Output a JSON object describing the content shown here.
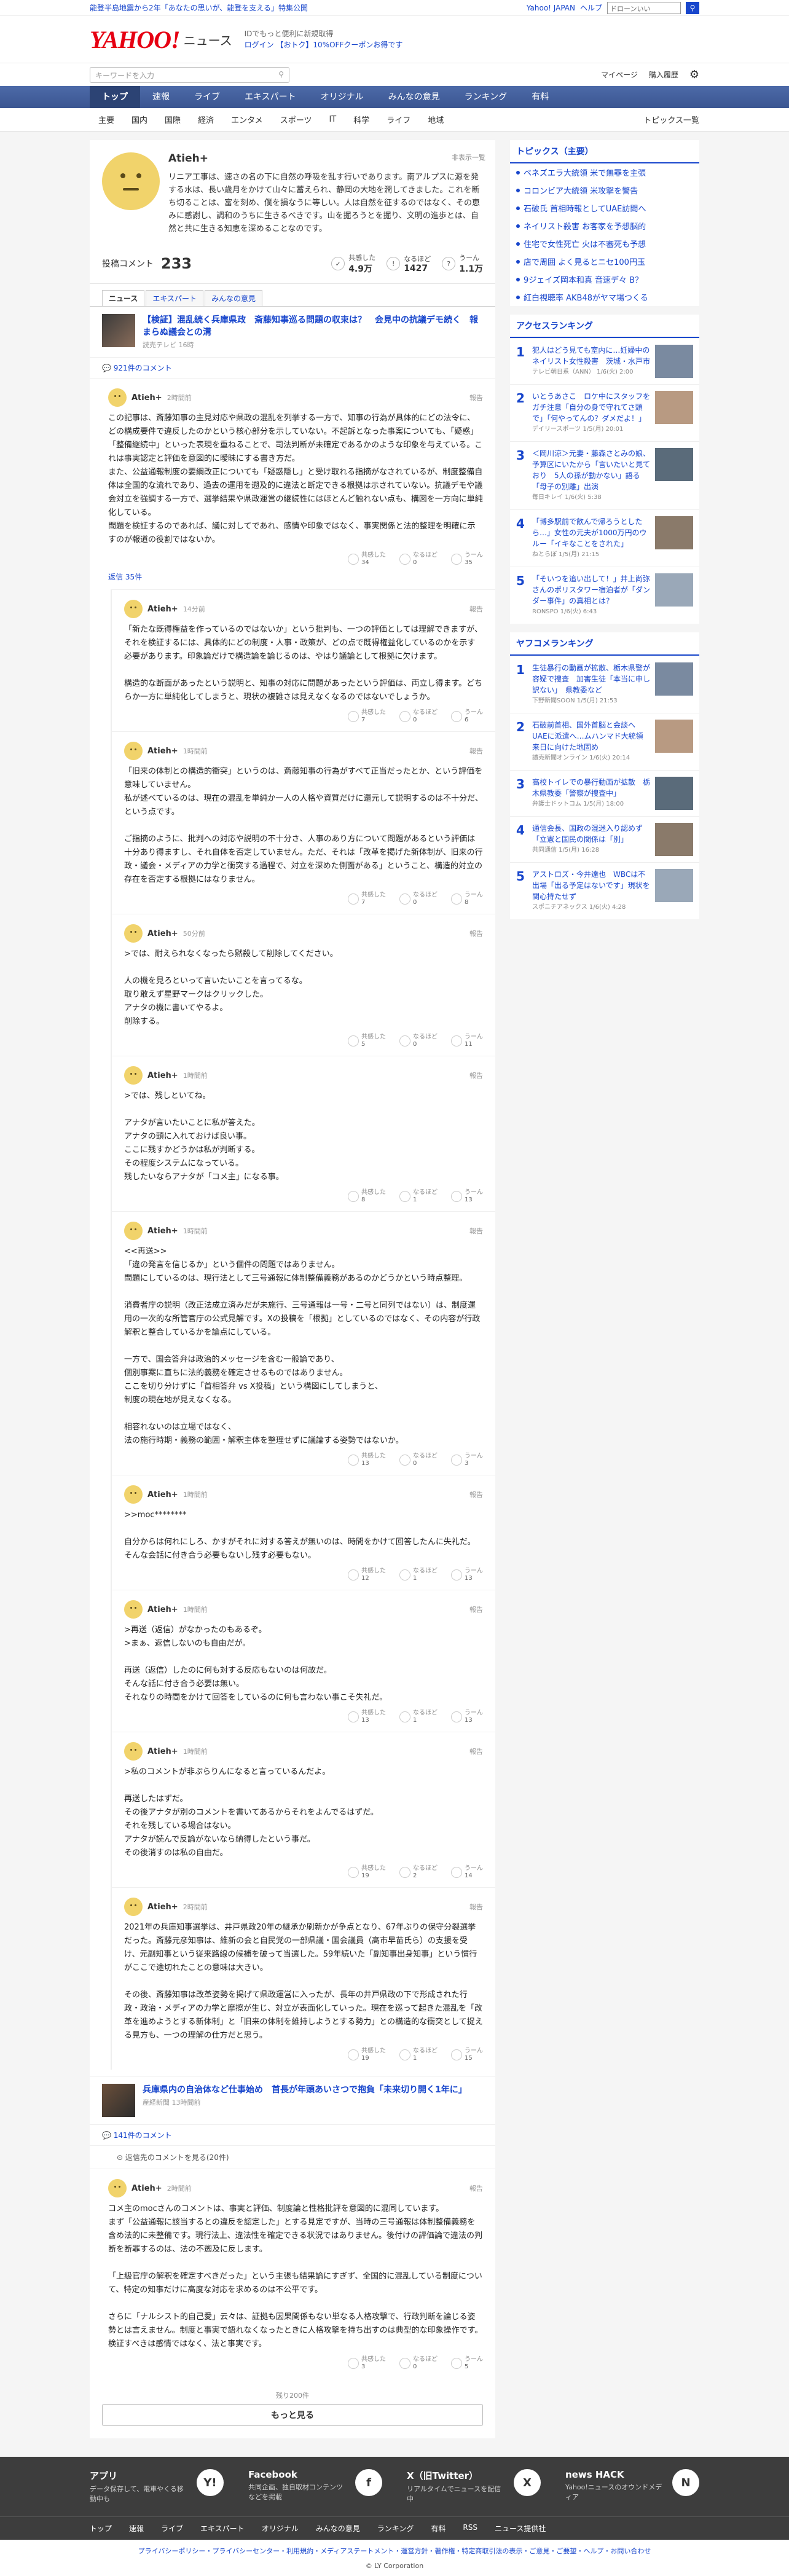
{
  "topbar": {
    "announce": "能登半島地震から2年「あなたの思いが、能登を支える」特集公開",
    "links": [
      "Yahoo! JAPAN",
      "ヘルプ"
    ],
    "search_placeholder": "ウェブ検索",
    "search_value": "ドローンいい"
  },
  "header": {
    "logo": "YAHOO!",
    "logo_sub": "ニュース",
    "promo_line1": "IDでもっと便利に新規取得",
    "promo_line2": "ログイン 【おトク】10%OFFクーポンお得です"
  },
  "search": {
    "placeholder": "キーワードを入力",
    "mypage": "マイページ",
    "purchase": "購入履歴"
  },
  "gnav": [
    "トップ",
    "速報",
    "ライブ",
    "エキスパート",
    "オリジナル",
    "みんなの意見",
    "ランキング",
    "有料"
  ],
  "subnav": [
    "主要",
    "国内",
    "国際",
    "経済",
    "エンタメ",
    "スポーツ",
    "IT",
    "科学",
    "ライフ",
    "地域"
  ],
  "subnav_topics": "トピックス一覧",
  "profile": {
    "name": "Atieh+",
    "hidden_label": "非表示一覧",
    "bio": "リニア工事は、速さの名の下に自然の呼吸を乱す行いであります。南アルプスに源を発する水は、長い歳月をかけて山々に蓄えられ、静岡の大地を潤してきました。これを断ち切ることは、富を刻め、僕を損なうに等しい。人は自然を征するのではなく、その恵みに感謝し、調和のうちに生きるべきです。山を掘ろうとを掘り、文明の進歩とは、自然と共に生きる知恵を深めることなのです。"
  },
  "stats": {
    "label": "投稿コメント",
    "count": "233",
    "m1_label": "共感した",
    "m1": "4.9万",
    "m2_label": "なるほど",
    "m2": "1427",
    "m3_label": "うーん",
    "m3": "1.1万"
  },
  "tabs": [
    "ニュース",
    "エキスパート",
    "みんなの意見"
  ],
  "article1": {
    "title": "【検証】混乱続く兵庫県政　斎藤知事巡る問題の収束は？　会見中の抗議デモ続く　報まらぬ議会との溝",
    "source": "読売テレビ 16時"
  },
  "article1_count": "921件のコメント",
  "comments": [
    {
      "name": "Atieh+",
      "time": "2時間前",
      "body": "この記事は、斎藤知事の主見対応や県政の混乱を列挙する一方で、知事の行為が具体的にどの法令に、どの構成要件で違反したのかという核心部分を示していない。不起訴となった事案についても、「疑惑」「整備継続中」といった表現を重ねることで、司法判断が未確定であるかのような印象を与えている。これは事実認定と評価を意図的に曖昧にする書き方だ。\nまた、公益通報制度の要綱改正についても「疑惑隠し」と受け取れる指摘がなされているが、制度整備自体は全国的な流れであり、過去の運用を遡及的に違法と断定できる根拠は示されていない。抗議デモや議会対立を強調する一方で、選挙結果や県政運営の継続性にはほとんど触れない点も、構図を一方向に単純化している。\n問題を検証するのであれば、議に対してであれ、感情や印象ではなく、事実関係と法的整理を明確に示すのが報道の役割ではないか。",
      "r1": "34",
      "r2": "0",
      "r3": "35",
      "replies": "返信 35件"
    },
    {
      "name": "Atieh+",
      "time": "14分前",
      "body": "「新たな既得権益を作っているのではないか」という批判も、一つの評価としては理解できますが、それを検証するには、具体的にどの制度・人事・政策が、どの点で既得権益化しているのかを示す必要があります。印象論だけで構造論を論じるのは、やはり議論として根拠に欠けます。\n\n構造的な断面があったという説明と、知事の対応に問題があったという評価は、両立し得ます。どちらか一方に単純化してしまうと、現状の複雑さは見えなくなるのではないでしょうか。",
      "r1": "7",
      "r2": "0",
      "r3": "6"
    },
    {
      "name": "Atieh+",
      "time": "1時間前",
      "body": "「旧来の体制との構造的衝突」というのは、斎藤知事の行為がすべて正当だったとか、という評価を意味していません。\n私が述べているのは、現在の混乱を単純か一人の人格や資質だけに還元して説明するのは不十分だ、という点です。\n\nご指摘のように、批判への対応や説明の不十分さ、人事のあり方について問題があるという評価は十分あり得ますし、それ自体を否定していません。ただ、それは「改革を掲げた新体制が、旧来の行政・議会・メディアの力学と衝突する過程で、対立を深めた側面がある」ということ、構造的対立の存在を否定する根拠にはなりません。",
      "r1": "7",
      "r2": "0",
      "r3": "8"
    },
    {
      "name": "Atieh+",
      "time": "50分前",
      "body": ">では、耐えられなくなったら黙殺して削除してください。\n\n人の機を見ろといって言いたいことを言ってるな。\n取り敢えず星野マークはクリックした。\nアナタの機に書いてやるよ。\n削除する。",
      "r1": "5",
      "r2": "0",
      "r3": "11"
    },
    {
      "name": "Atieh+",
      "time": "1時間前",
      "body": ">では、残しといてね。\n\nアナタが言いたいことに私が答えた。\nアナタの頭に入れておけば良い事。\nここに残すかどうかは私が判断する。\nその程度システムになっている。\n残したいならアナタが「コメ主」になる事。",
      "r1": "8",
      "r2": "1",
      "r3": "13"
    },
    {
      "name": "Atieh+",
      "time": "1時間前",
      "body": "<<再送>>\n「違の発言を信じるか」という個件の問題ではありません。\n問題にしているのは、現行法として三号通報に体制整備義務があるのかどうかという時点整理。\n\n消費者庁の説明（改正法成立済みだが未施行、三号通報は一号・二号と同列ではない）は、制度運用の一次的な所管官庁の公式見解です。Xの投稿を「根拠」としているのではなく、その内容が行政解釈と整合しているかを論点にしている。\n\n一方で、国会答弁は政治的メッセージを含む一般論であり、\n個別事案に直ちに法的義務を確定させるものではありません。\nここを切り分けずに「首相答弁 vs X投稿」という構図にしてしまうと、\n制度の現在地が見えなくなる。\n\n相容れないのは立場ではなく、\n法の施行時期・義務の範囲・解釈主体を整理せずに議論する姿勢ではないか。",
      "r1": "13",
      "r2": "0",
      "r3": "3"
    },
    {
      "name": "Atieh+",
      "time": "1時間前",
      "body": ">>moc********\n\n自分からは何れにしろ、かすがそれに対する答えが無いのは、時間をかけて回答したんに失礼だ。\nそんな会話に付き合う必要もないし残す必要もない。",
      "r1": "12",
      "r2": "1",
      "r3": "13"
    },
    {
      "name": "Atieh+",
      "time": "1時間前",
      "body": ">再送（返信）がなかったのもあるぞ。\n>まぁ、返信しないのも自由だが。\n\n再送（返信）したのに何も対する反応もないのは何故だ。\nそんな話に付き合う必要は無い。\nそれなりの時間をかけて回答をしているのに何も言わない事こそ失礼だ。",
      "r1": "13",
      "r2": "1",
      "r3": "13"
    },
    {
      "name": "Atieh+",
      "time": "1時間前",
      "body": ">私のコメントが非ぷらりんになると言っているんだよ。\n\n再送したはずだ。\nその後アナタが別のコメントを書いてあるからそれをよんでるはずだ。\nそれを残している場合はない。\nアナタが読んで反論がないなら納得したという事だ。\nその後消すのは私の自由だ。",
      "r1": "19",
      "r2": "2",
      "r3": "14"
    },
    {
      "name": "Atieh+",
      "time": "2時間前",
      "body": "2021年の兵庫知事選挙は、井戸県政20年の継承か刷新かが争点となり、67年ぶりの保守分裂選挙だった。斎藤元彦知事は、維新の会と自民党の一部県議・国会議員（高市早苗氏ら）の支援を受け、元副知事という従来路線の候補を破って当選した。59年続いた「副知事出身知事」という慣行がここで途切れたことの意味は大きい。\n\nその後、斎藤知事は改革姿勢を掲げて県政運営に入ったが、長年の井戸県政の下で形成された行政・政治・メディアの力学と摩擦が生じ、対立が表面化していった。現在を巡って起きた混乱を「改革を進めようとする新体制」と「旧来の体制を維持しようとする勢力」との構造的な衝突として捉える見方も、一つの理解の仕方だと思う。",
      "r1": "19",
      "r2": "1",
      "r3": "15"
    }
  ],
  "article2": {
    "title": "兵庫県内の自治体など仕事始め　首長が年頭あいさつで抱負「未来切り開く1年に」",
    "source": "産経新聞 13時間前"
  },
  "article2_count": "141件のコメント",
  "collapsed": "返信先のコメントを見る(20件)",
  "last_comment": {
    "name": "Atieh+",
    "time": "2時間前",
    "body": "コメ主のmocさんのコメントは、事実と評価、制度論と性格批評を意図的に混同しています。\nまず「公益通報に該当するとの違反を認定した」とする見定ですが、当時の三号通報は体制整備義務を含め法的に未整備です。現行法上、違法性を確定できる状況ではありません。後付けの評価論で違法の判断を断罪するのは、法の不遡及に反します。\n\n「上級官庁の解釈を確定すべきだった」という主張も結果論にすぎず、全国的に混乱している制度について、特定の知事だけに高度な対応を求めるのは不公平です。\n\nさらに「ナルシスト的自己愛」云々は、証拠も因果関係もない単なる人格攻撃で、行政判断を論じる姿勢とは言えません。制度と事実で語れなくなったときに人格攻撃を持ち出すのは典型的な印象操作です。検証すべきは感情ではなく、法と事実です。",
    "r1": "3",
    "r2": "0",
    "r3": "5"
  },
  "more": {
    "rest": "残り200件",
    "button": "もっと見る"
  },
  "sidebar": {
    "topics_title": "トピックス（主要）",
    "topics": [
      "ベネズエラ大統領 米で無罪を主張",
      "コロンビア大統領 米攻撃を警告",
      "石破氏 首相時報としてUAE訪問へ",
      "ネイリスト殺害 お客家を予想脳的",
      "住宅で女性死亡 火は不審死も予想",
      "店で周囲 よく見るとニセ100円玉",
      "9ジェイズ岡本和真 音速デ々 B？",
      "紅白視聴率 AKB48がヤマ場つくる"
    ],
    "access_title": "アクセスランキング",
    "access": [
      {
        "t": "犯人はどう見ても室内に…妊婦中のネイリスト女性殺害　茨城・水戸市",
        "s": "テレビ朝日系（ANN） 1/6(火) 2:00"
      },
      {
        "t": "いとうあさこ　ロケ中にスタッフをガチ注意「自分の身で守れてさ頭で」「何やってんの？ダメだよ！」",
        "s": "デイリースポーツ 1/5(月) 20:01"
      },
      {
        "t": "＜岡川涼＞元妻・藤森さとみの娘、予算区にいたから「言いたいと見ており　5人の孫が動かない」語る「母子の別離」出演",
        "s": "毎日キレイ 1/6(火) 5:38"
      },
      {
        "t": "「博多駅前で飲んで帰ろうとしたら…」女性の元夫が1000万円のウルー「イキなことをされた」",
        "s": "ねとらぼ 1/5(月) 21:15"
      },
      {
        "t": "「そいつを追い出して！」井上尚弥さんのポリスタワー宿泊者が「ダンダー事件」の真相とは？",
        "s": "RONSPO 1/6(火) 6:43"
      }
    ],
    "yahoo_title": "ヤフコメランキング",
    "yahoo": [
      {
        "t": "生徒暴行の動画が拡散、栃木県警が容疑で捜査　加害生徒「本当に申し訳ない」　県教委など",
        "s": "下野新聞SOON 1/5(月) 21:53"
      },
      {
        "t": "石破前首相、国外首脳と会談へ　UAEに派遣へ…ムハンマド大統領来日に向けた地固め",
        "s": "讀売新聞オンライン 1/6(火) 20:14"
      },
      {
        "t": "高校トイレでの暴行動画が拡散　栃木県教委「警察が捜査中」",
        "s": "弁護士ドットコム 1/5(月) 18:00"
      },
      {
        "t": "通信会長、国政の混迷入り認めず「立憲と国民の関係は「別」",
        "s": "共同通信 1/5(月) 16:28"
      },
      {
        "t": "アストロズ・今井達也　WBCは不出場「出る予定はないです」現状を関心持たせず",
        "s": "スポニチアネックス 1/6(火) 4:28"
      }
    ]
  },
  "footer": {
    "cols": [
      {
        "t": "アプリ",
        "d": "データ保存して、電車やくる移動中も",
        "i": "Y!"
      },
      {
        "t": "Facebook",
        "d": "共同企画、独自取材コンテンツなどを掲載",
        "i": "f"
      },
      {
        "t": "X（旧Twitter）",
        "d": "リアルタイムでニュースを配信中",
        "i": "X"
      },
      {
        "t": "news HACK",
        "d": "Yahoo!ニュースのオウンドメディア",
        "i": "N"
      }
    ],
    "nav": [
      "トップ",
      "速報",
      "ライブ",
      "エキスパート",
      "オリジナル",
      "みんなの意見",
      "ランキング",
      "有料",
      "RSS",
      "ニュース提供社"
    ],
    "legal": "プライバシーポリシー・プライバシーセンター・利用規約・メディアステートメント・運営方針・著作権・特定商取引法の表示・ご意見・ご要望・ヘルプ・お問い合わせ",
    "copy": "© LY Corporation"
  }
}
